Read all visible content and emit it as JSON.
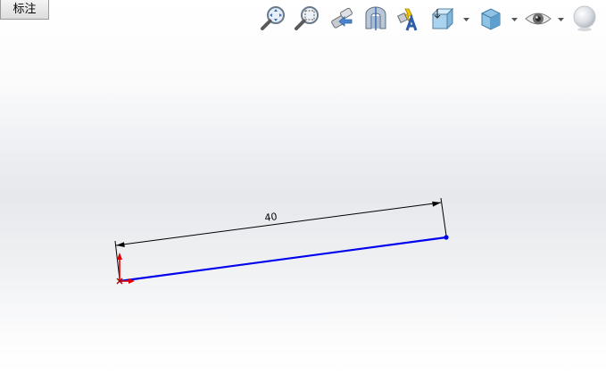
{
  "feature_tab": {
    "label": "标注"
  },
  "heads_up_toolbar": {
    "tools": [
      "zoom-to-fit-icon",
      "zoom-to-area-icon",
      "previous-view-icon",
      "section-view-icon",
      "view-orientation-icon",
      "display-style-icon",
      "hide-show-items-icon",
      "edit-appearance-icon",
      "apply-scene-icon"
    ]
  },
  "sketch": {
    "dimension_value": "40",
    "line_color": "#0000ee",
    "dimension_color": "#000000",
    "origin_color": "#dd0000"
  }
}
